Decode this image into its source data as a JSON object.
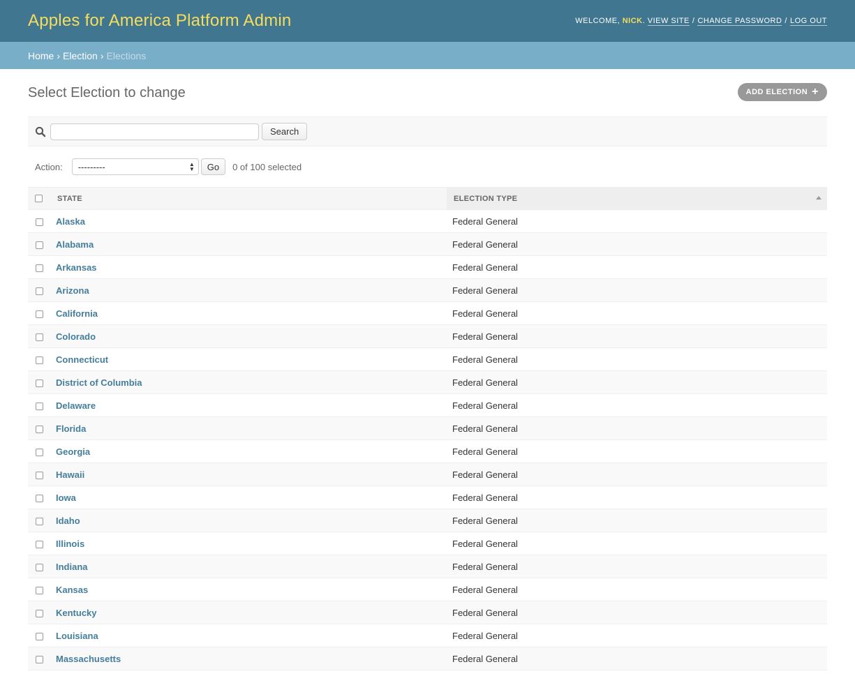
{
  "header": {
    "site_name": "Apples for America Platform Admin",
    "welcome": "WELCOME,",
    "user": "NICK",
    "view_site": "VIEW SITE",
    "change_password": "CHANGE PASSWORD",
    "log_out": "LOG OUT",
    "separator": "/"
  },
  "breadcrumbs": {
    "home": "Home",
    "app": "Election",
    "current": "Elections",
    "arrow": "›"
  },
  "page": {
    "title": "Select Election to change",
    "add_button": "ADD ELECTION",
    "add_icon": "plus-icon"
  },
  "search": {
    "value": "",
    "placeholder": "",
    "button": "Search",
    "icon": "search-icon"
  },
  "actions": {
    "label": "Action:",
    "selected_option": "---------",
    "go": "Go",
    "counter": "0 of 100 selected"
  },
  "table": {
    "columns": [
      "State",
      "Election Type"
    ],
    "sorted_column": "Election Type",
    "rows": [
      {
        "state": "Alaska",
        "type": "Federal General"
      },
      {
        "state": "Alabama",
        "type": "Federal General"
      },
      {
        "state": "Arkansas",
        "type": "Federal General"
      },
      {
        "state": "Arizona",
        "type": "Federal General"
      },
      {
        "state": "California",
        "type": "Federal General"
      },
      {
        "state": "Colorado",
        "type": "Federal General"
      },
      {
        "state": "Connecticut",
        "type": "Federal General"
      },
      {
        "state": "District of Columbia",
        "type": "Federal General"
      },
      {
        "state": "Delaware",
        "type": "Federal General"
      },
      {
        "state": "Florida",
        "type": "Federal General"
      },
      {
        "state": "Georgia",
        "type": "Federal General"
      },
      {
        "state": "Hawaii",
        "type": "Federal General"
      },
      {
        "state": "Iowa",
        "type": "Federal General"
      },
      {
        "state": "Idaho",
        "type": "Federal General"
      },
      {
        "state": "Illinois",
        "type": "Federal General"
      },
      {
        "state": "Indiana",
        "type": "Federal General"
      },
      {
        "state": "Kansas",
        "type": "Federal General"
      },
      {
        "state": "Kentucky",
        "type": "Federal General"
      },
      {
        "state": "Louisiana",
        "type": "Federal General"
      },
      {
        "state": "Massachusetts",
        "type": "Federal General"
      }
    ]
  },
  "colors": {
    "header_bg": "#417690",
    "site_name": "#f5dd5d",
    "breadcrumb_bg": "#79aec8",
    "link": "#447e9b"
  }
}
